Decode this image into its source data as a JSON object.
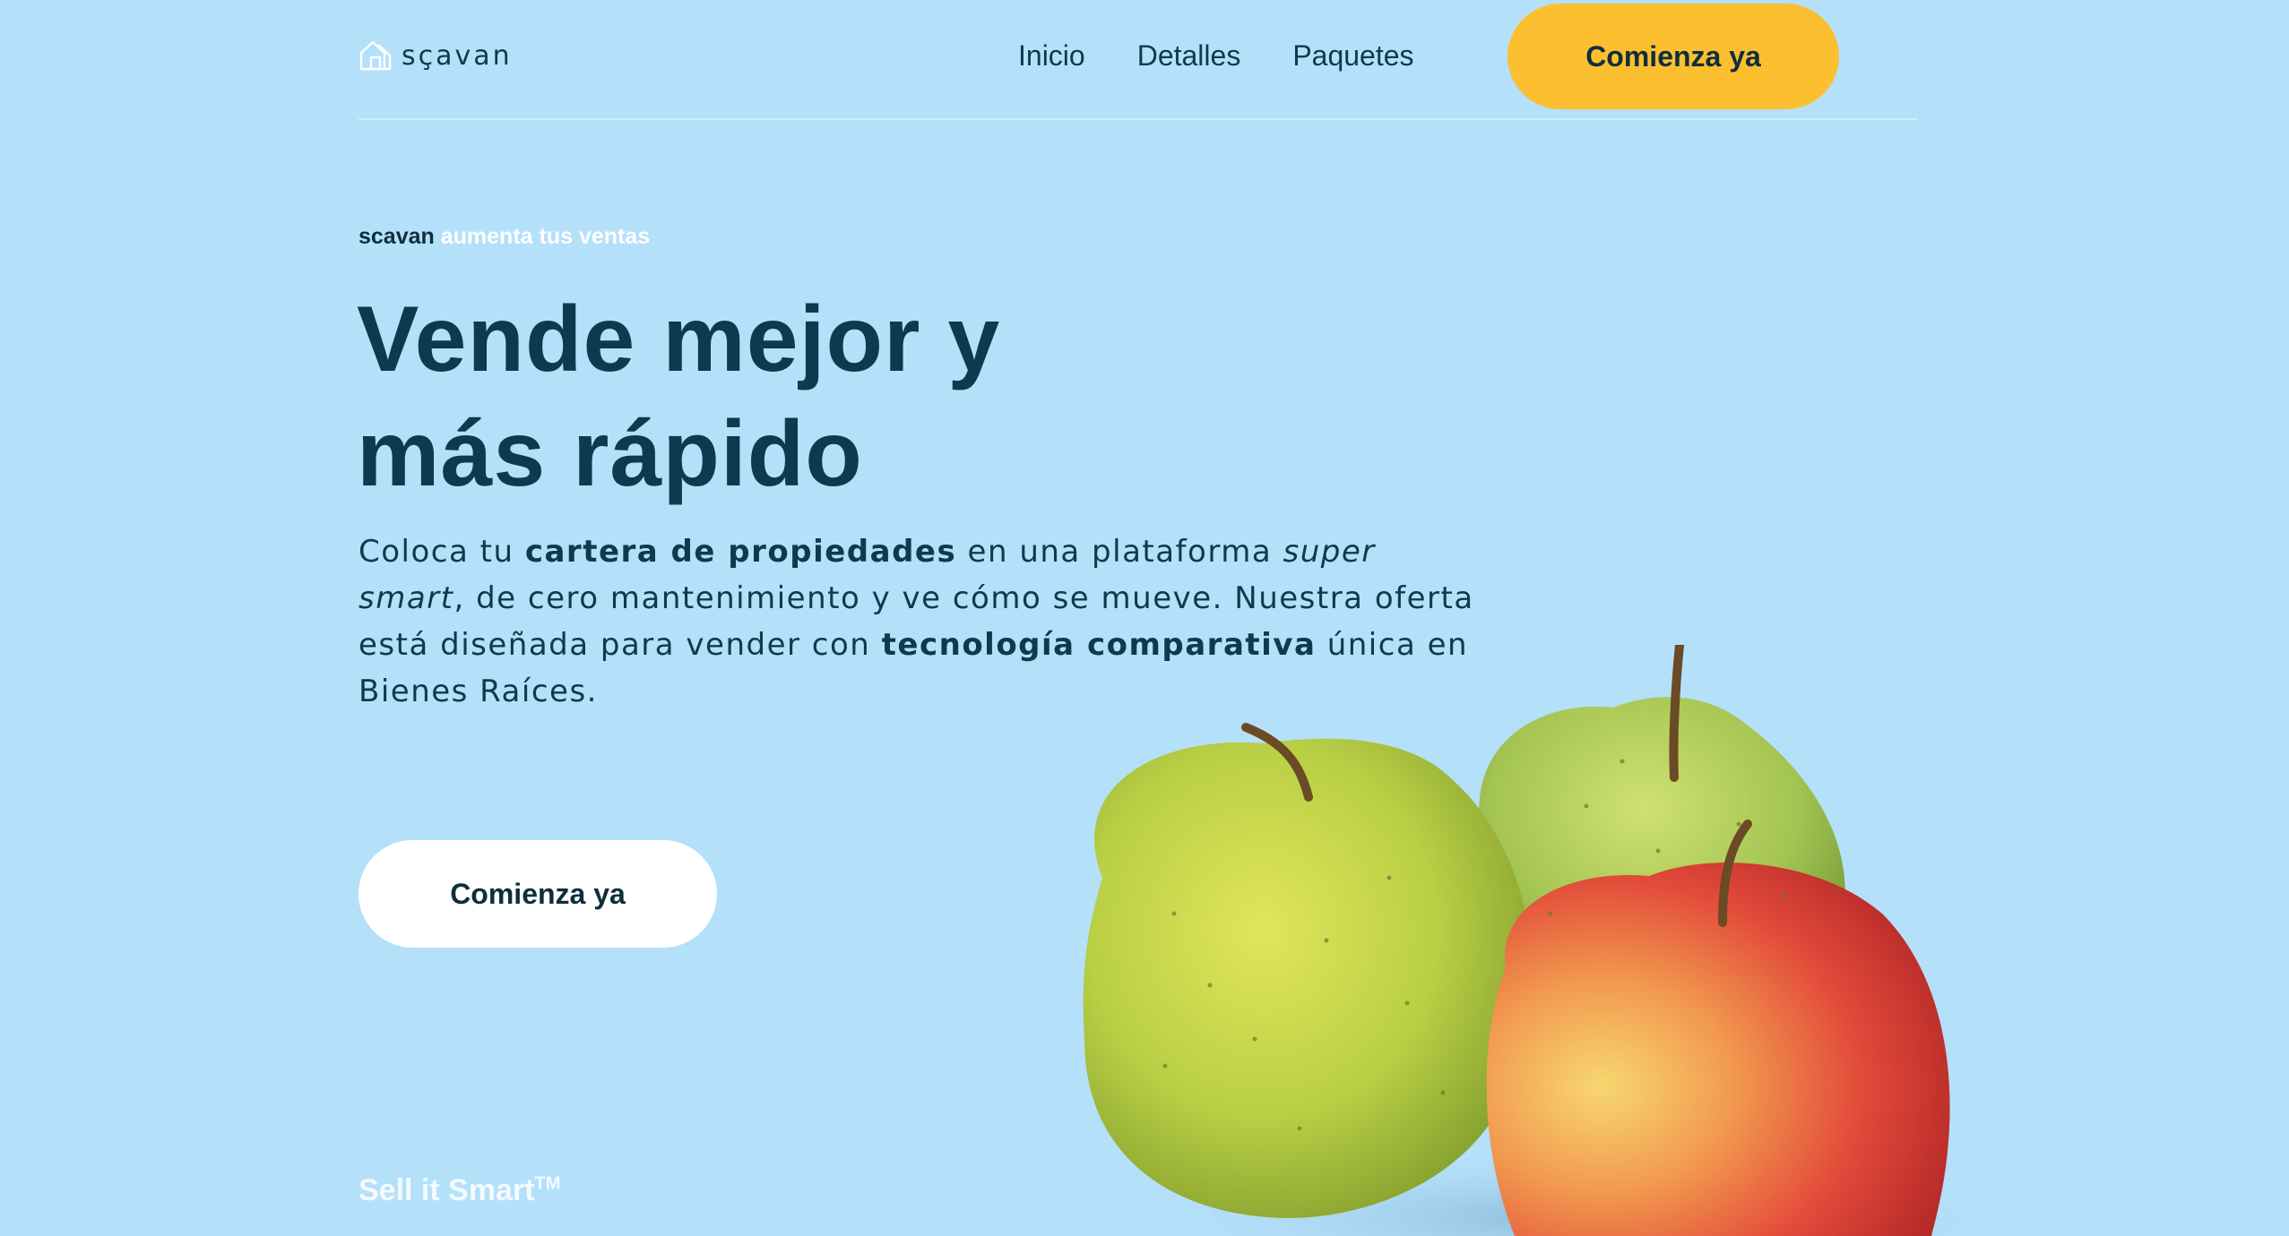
{
  "header": {
    "logo_text": "sçavan",
    "nav": [
      "Inicio",
      "Detalles",
      "Paquetes"
    ],
    "cta_label": "Comienza ya"
  },
  "hero": {
    "eyebrow_brand": "scavan",
    "eyebrow_text": "aumenta tus ventas",
    "headline_line1": "Vende mejor y",
    "headline_line2": "más rápido",
    "lead": {
      "p1": "Coloca tu ",
      "b1": "cartera de propiedades",
      "p2": " en una plataforma ",
      "i1": "super smart",
      "p3": ", de cero mantenimiento y ve cómo se mueve. Nuestra oferta está diseñada para vender con ",
      "b2": "tecnología comparativa",
      "p4": " única en Bienes Raíces."
    },
    "cta_label": "Comienza ya",
    "tagline": "Sell it Smart",
    "tagline_mark": "TM"
  },
  "colors": {
    "background": "#b5e0fa",
    "text": "#0e3a4f",
    "accent": "#fcbf2f",
    "white": "#ffffff"
  },
  "icons": {
    "logo": "house-outline-icon"
  }
}
